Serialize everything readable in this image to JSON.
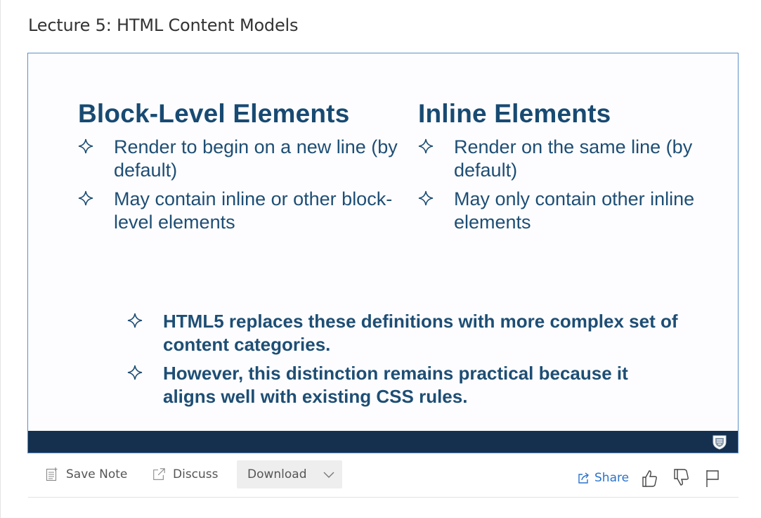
{
  "page": {
    "title": "Lecture 5: HTML Content Models"
  },
  "slide": {
    "left_column": {
      "heading": "Block-Level Elements",
      "bullets": [
        "Render to begin on a new line (by default)",
        "May contain inline or other block-level elements"
      ]
    },
    "right_column": {
      "heading": "Inline Elements",
      "bullets": [
        "Render on the same line (by default)",
        "May only contain other inline elements"
      ]
    },
    "bottom_bullets": [
      "HTML5 replaces these definitions with more complex set of content categories.",
      "However, this distinction remains practical because it aligns well with existing CSS rules."
    ],
    "bullet_icon": "four-point-star-icon",
    "footer_logo": "university-crest-icon",
    "colors": {
      "heading": "#184a72",
      "footer_bar": "#15304f",
      "frame_border": "#5a8fc7"
    }
  },
  "toolbar": {
    "save_note_label": "Save Note",
    "discuss_label": "Discuss",
    "download_label": "Download",
    "share_label": "Share",
    "icons": {
      "save_note": "note-icon",
      "discuss": "external-link-icon",
      "download_toggle": "chevron-down-icon",
      "share": "share-icon",
      "like": "thumbs-up-icon",
      "dislike": "thumbs-down-icon",
      "flag": "flag-icon"
    },
    "colors": {
      "share_link": "#2a73cc",
      "download_bg": "#eeeeee"
    }
  }
}
